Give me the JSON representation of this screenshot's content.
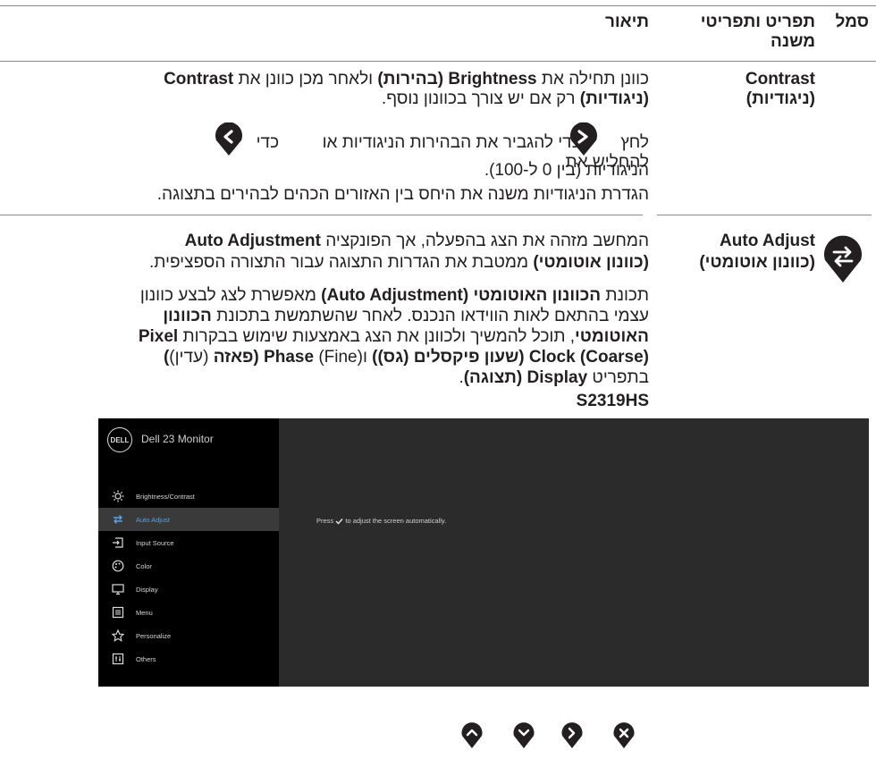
{
  "header": {
    "col_icon": "סמל",
    "col_menu_line1": "תפריט ותפריטי",
    "col_menu_line2": "משנה",
    "col_desc": "תיאור"
  },
  "contrast_row": {
    "name_line1": "Contrast",
    "name_line2": "(ניגודיות)",
    "p1_line1_a": "כוונן תחילה את ",
    "p1_line1_b": "Brightness (בהירות)",
    "p1_line1_c": " ולאחר מכן כוונן את ",
    "p1_line1_d": "Contrast",
    "p1_line2_a": "(ניגודיות)",
    "p1_line2_b": " רק אם יש צורך בכוונון נוסף.",
    "p2_a": "לחץ ",
    "p2_b": " כדי להגביר את הבהירות הניגודיות או ",
    "p2_c": " כדי להחליש את",
    "p2_line2": "הניגודיות (בין 0 ל-100).",
    "p3": "הגדרת הניגודיות משנה את היחס בין האזורים הכהים לבהירים בתצוגה."
  },
  "auto_row": {
    "name_line1": "Auto Adjust",
    "name_line2": "(כוונון אוטומטי)",
    "p1_l1_a": "המחשב מזהה את הצג בהפעלה, אך הפונקציה ",
    "p1_l1_b": "Auto Adjustment",
    "p1_l2_a": "(כוונון אוטומטי)",
    "p1_l2_b": " ממטבת את הגדרות התצוגה עבור התצורה הספציפית.",
    "p2_l1_a": "תכונת ",
    "p2_l1_b": "הכוונון האוטומטי (Auto Adjustment)",
    "p2_l1_c": " מאפשרת לצג לבצע כוונון",
    "p2_l2_a": "עצמי בהתאם לאות הווידאו הנכנס. לאחר שהשתמשת בתכונת ",
    "p2_l2_b": "הכוונון",
    "p2_l3_a": "האוטומטי",
    "p2_l3_b": ", תוכל להמשיך ולכוונן את הצג באמצעות שימוש בבקרות ",
    "p2_l3_c": "Pixel",
    "p2_l4_a": "Clock (Coarse) (שעון פיקסלים (גס))",
    "p2_l4_b": " ו",
    "p2_l4_c": "(Fine)",
    "p2_l4_d": " ",
    "p2_l4_e": "Phase (פאזה",
    "p2_l4_f": " (עדין)",
    "p2_l4_g": ")",
    "p2_l5_a": "בתפריט ",
    "p2_l5_b": "Display (תצוגה)",
    "p2_l5_c": ".",
    "model": "S2319HS"
  },
  "osd": {
    "logo": "DELL",
    "title": "Dell 23 Monitor",
    "menu": [
      {
        "label": "Brightness/Contrast",
        "icon": "sun-icon"
      },
      {
        "label": "Auto Adjust",
        "icon": "auto-adjust-icon"
      },
      {
        "label": "Input Source",
        "icon": "input-icon"
      },
      {
        "label": "Color",
        "icon": "color-icon"
      },
      {
        "label": "Display",
        "icon": "display-icon"
      },
      {
        "label": "Menu",
        "icon": "menu-icon"
      },
      {
        "label": "Personalize",
        "icon": "star-icon"
      },
      {
        "label": "Others",
        "icon": "others-icon"
      }
    ],
    "message_a": "Press",
    "message_b": "to adjust the screen automatically.",
    "selected_index": 1
  },
  "buttons": [
    "up-icon",
    "down-icon",
    "right-icon",
    "close-icon"
  ],
  "colors": {
    "pin": "#231f20",
    "osd_bg": "#000000",
    "osd_panel": "#2b2b2b",
    "osd_active": "#5aa0e6"
  }
}
